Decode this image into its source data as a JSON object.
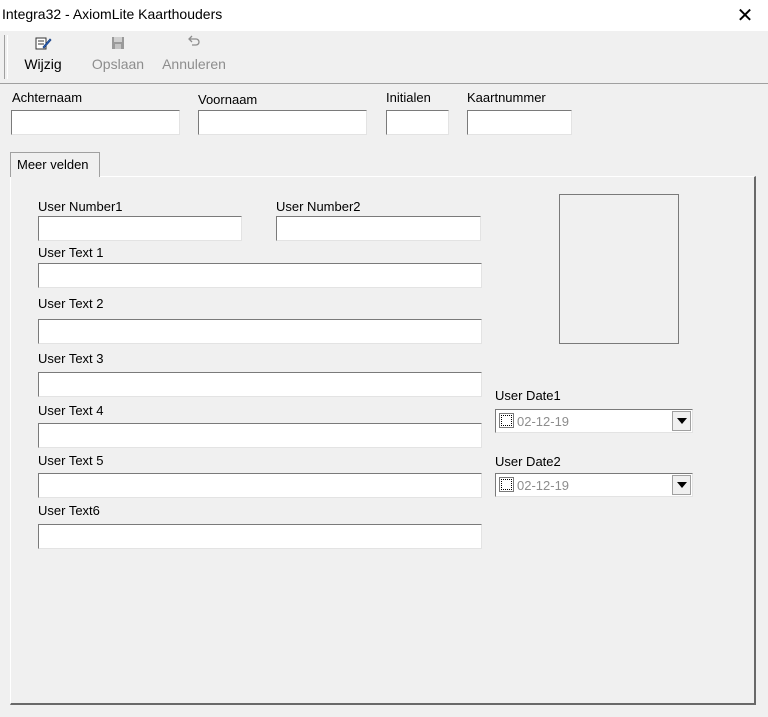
{
  "window": {
    "title": "Integra32 - AxiomLite Kaarthouders",
    "close_symbol": "✕"
  },
  "toolbar": {
    "edit": {
      "label": "Wijzig",
      "icon": "edit-icon"
    },
    "save": {
      "label": "Opslaan",
      "icon": "save-icon"
    },
    "cancel": {
      "label": "Annuleren",
      "icon": "undo-icon"
    }
  },
  "header_fields": {
    "achternaam": {
      "label": "Achternaam",
      "value": ""
    },
    "voornaam": {
      "label": "Voornaam",
      "value": ""
    },
    "initialen": {
      "label": "Initialen",
      "value": ""
    },
    "kaartnummer": {
      "label": "Kaartnummer",
      "value": ""
    }
  },
  "tabs": [
    {
      "label": "Meer velden",
      "selected": true
    }
  ],
  "fields": {
    "user_number1": {
      "label": "User Number1",
      "value": ""
    },
    "user_number2": {
      "label": "User Number2",
      "value": ""
    },
    "user_text1": {
      "label": "User Text 1",
      "value": ""
    },
    "user_text2": {
      "label": "User Text 2",
      "value": ""
    },
    "user_text3": {
      "label": "User Text 3",
      "value": ""
    },
    "user_text4": {
      "label": "User Text 4",
      "value": ""
    },
    "user_text5": {
      "label": "User Text 5",
      "value": ""
    },
    "user_text6": {
      "label": "User Text6",
      "value": ""
    },
    "user_date1": {
      "label": "User Date1",
      "value": "02-12-19",
      "checked": false
    },
    "user_date2": {
      "label": "User Date2",
      "value": "02-12-19",
      "checked": false
    }
  },
  "colors": {
    "window_bg": "#f0f0f0",
    "disabled_text": "#8d8d8d"
  }
}
